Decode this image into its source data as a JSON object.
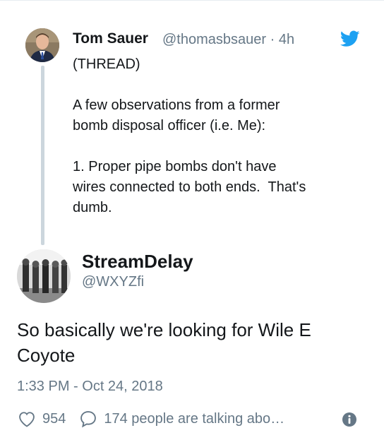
{
  "first_tweet": {
    "author_name": "Tom Sauer",
    "meta": "@thomasbsauer · 4h",
    "text": "(THREAD)\n\nA few observations from a former\nbomb disposal officer (i.e. Me):\n\n1. Proper pipe bombs don't have\nwires connected to both ends.  That's\ndumb."
  },
  "reply_tweet": {
    "author_name": "StreamDelay",
    "handle": "@WXYZfi",
    "text": "So basically we're looking for Wile E Coyote",
    "timestamp": "1:33 PM - Oct 24, 2018"
  },
  "actions": {
    "like_count": "954",
    "talking_label": "174 people are talking abo…"
  },
  "icons": {
    "brand": "twitter-bird-icon",
    "like": "heart-icon",
    "reply": "speech-bubble-icon",
    "info": "info-icon"
  },
  "colors": {
    "twitter_blue": "#1da1f2",
    "secondary_text": "#657786",
    "thread_line": "#ccd6dd"
  }
}
